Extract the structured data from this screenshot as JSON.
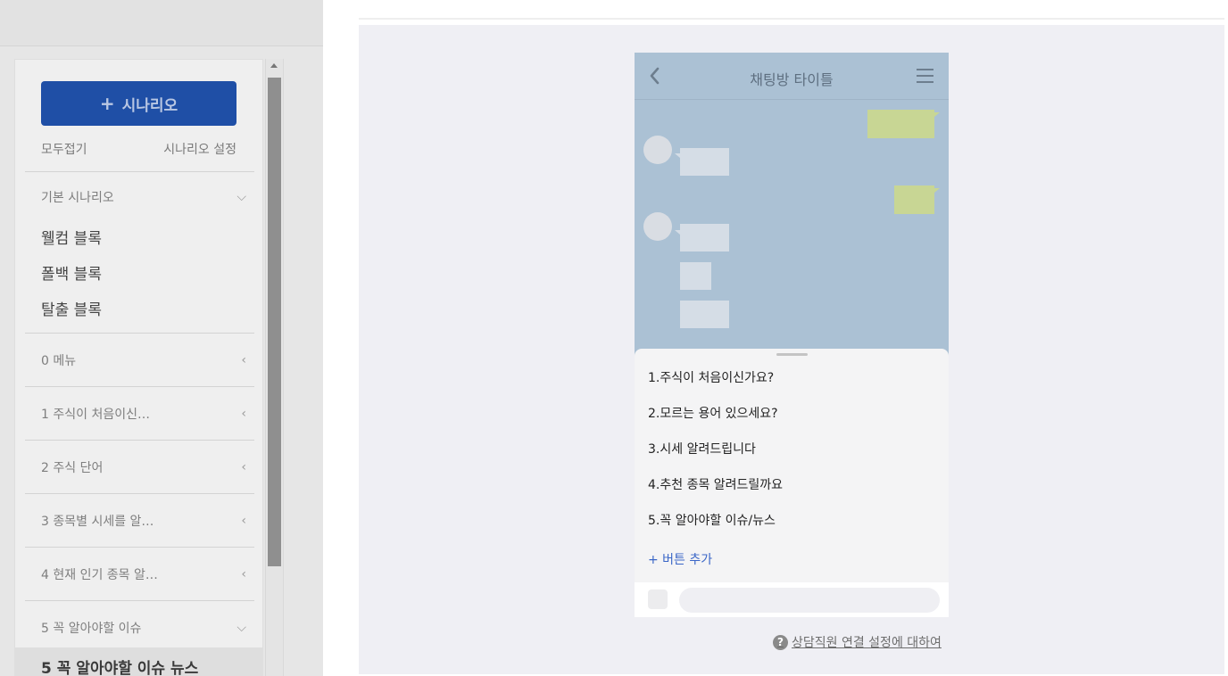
{
  "sidebar": {
    "add_scenario_label": "시나리오",
    "collapse_all_label": "모두접기",
    "scenario_settings_label": "시나리오 설정",
    "basic_scenario": {
      "label": "기본 시나리오",
      "items": [
        "웰컴 블록",
        "폴백 블록",
        "탈출 블록"
      ]
    },
    "groups": [
      {
        "label": "0 메뉴"
      },
      {
        "label": "1 주식이 처음이신…"
      },
      {
        "label": "2 주식 단어"
      },
      {
        "label": "3 종목별 시세를 알…"
      },
      {
        "label": "4 현재 인기 종목 알…"
      },
      {
        "label": "5 꼭 알아야할 이슈"
      }
    ],
    "selected_block": "5 꼭 알아야할 이슈 뉴스"
  },
  "preview": {
    "chat_title": "채팅방 타이틀",
    "menu_options": [
      "1.주식이 처음이신가요?",
      "2.모르는 용어 있으세요?",
      "3.시세 알려드립니다",
      "4.추천 종목 알려드릴까요",
      "5.꼭 알아야할 이슈/뉴스"
    ],
    "add_button_label": "+ 버튼 추가",
    "help_link_label": "상담직원 연결 설정에 대하여"
  },
  "colors": {
    "primary_button": "#1f4fa6",
    "chat_background": "#abc1d4",
    "my_bubble": "#c8d694",
    "link_blue": "#3a66c7"
  }
}
